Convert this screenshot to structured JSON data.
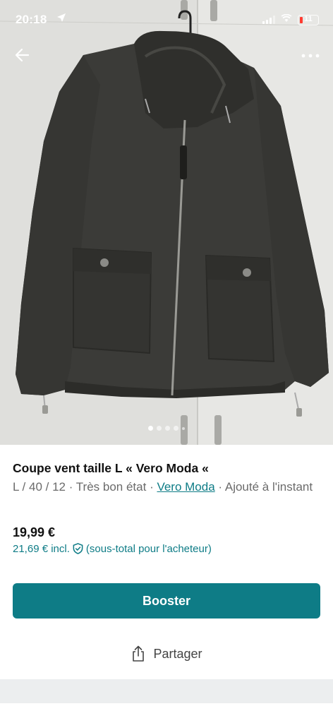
{
  "status_bar": {
    "time": "20:18",
    "battery": "11"
  },
  "photo": {
    "carousel": {
      "total": 5,
      "active_index": 0
    }
  },
  "listing": {
    "title": "Coupe vent taille L  «  Vero Moda «",
    "size": "L / 40 / 12",
    "condition": "Très bon état",
    "brand": "Vero Moda",
    "added": "Ajouté à l'instant",
    "separator": " · "
  },
  "pricing": {
    "price": "19,99 €",
    "incl_price": "21,69 € incl.",
    "incl_note": "(sous-total pour l'acheteur)"
  },
  "actions": {
    "boost_label": "Booster",
    "share_label": "Partager"
  },
  "colors": {
    "accent": "#0e7c86",
    "battery_low": "#ff3b30"
  }
}
